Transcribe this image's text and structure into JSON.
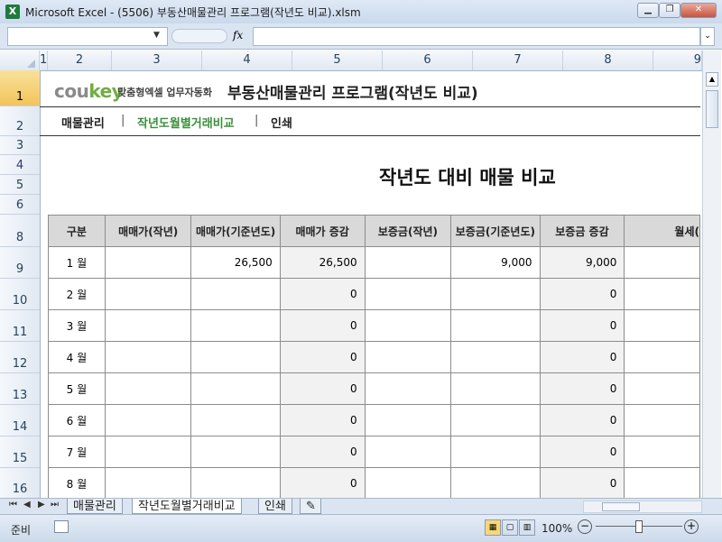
{
  "window": {
    "title": "Microsoft Excel - (5506) 부동산매물관리 프로그램(작년도 비교).xlsm",
    "controls": [
      "minimize-icon",
      "restore-icon",
      "close-icon"
    ]
  },
  "formula_bar": {
    "name_box": "",
    "fx_label": "fx",
    "formula": ""
  },
  "column_headers": [
    "1",
    "2",
    "3",
    "4",
    "5",
    "6",
    "7",
    "8",
    "9"
  ],
  "row_headers": [
    "1",
    "2",
    "3",
    "4",
    "5",
    "6",
    "8",
    "9",
    "10",
    "11",
    "12",
    "13",
    "14",
    "15",
    "16"
  ],
  "sheet": {
    "logo_cou": "cou",
    "logo_key": "key",
    "logo_sub": "맞춤형엑셀 업무자동화",
    "app_title": "부동산매물관리 프로그램(작년도 비교)",
    "nav": [
      "매물관리",
      "작년도월별거래비교",
      "인쇄"
    ],
    "nav_active_color": "#3a8f3a",
    "report_title": "작년도 대비 매물 비교"
  },
  "table": {
    "headers": [
      "구분",
      "매매가(작년)",
      "매매가(기준년도)",
      "매매가 증감",
      "보증금(작년)",
      "보증금(기준년도)",
      "보증금 증감",
      "월세("
    ],
    "rows": [
      [
        "1 월",
        "",
        "26,500",
        "26,500",
        "",
        "9,000",
        "9,000",
        ""
      ],
      [
        "2 월",
        "",
        "",
        "0",
        "",
        "",
        "0",
        ""
      ],
      [
        "3 월",
        "",
        "",
        "0",
        "",
        "",
        "0",
        ""
      ],
      [
        "4 월",
        "",
        "",
        "0",
        "",
        "",
        "0",
        ""
      ],
      [
        "5 월",
        "",
        "",
        "0",
        "",
        "",
        "0",
        ""
      ],
      [
        "6 월",
        "",
        "",
        "0",
        "",
        "",
        "0",
        ""
      ],
      [
        "7 월",
        "",
        "",
        "0",
        "",
        "",
        "0",
        ""
      ],
      [
        "8 월",
        "",
        "",
        "0",
        "",
        "",
        "0",
        ""
      ]
    ]
  },
  "sheet_tabs": [
    "매물관리",
    "작년도월별거래비교",
    "인쇄"
  ],
  "active_tab": "작년도월별거래비교",
  "status": {
    "mode": "준비",
    "zoom": "100%"
  }
}
